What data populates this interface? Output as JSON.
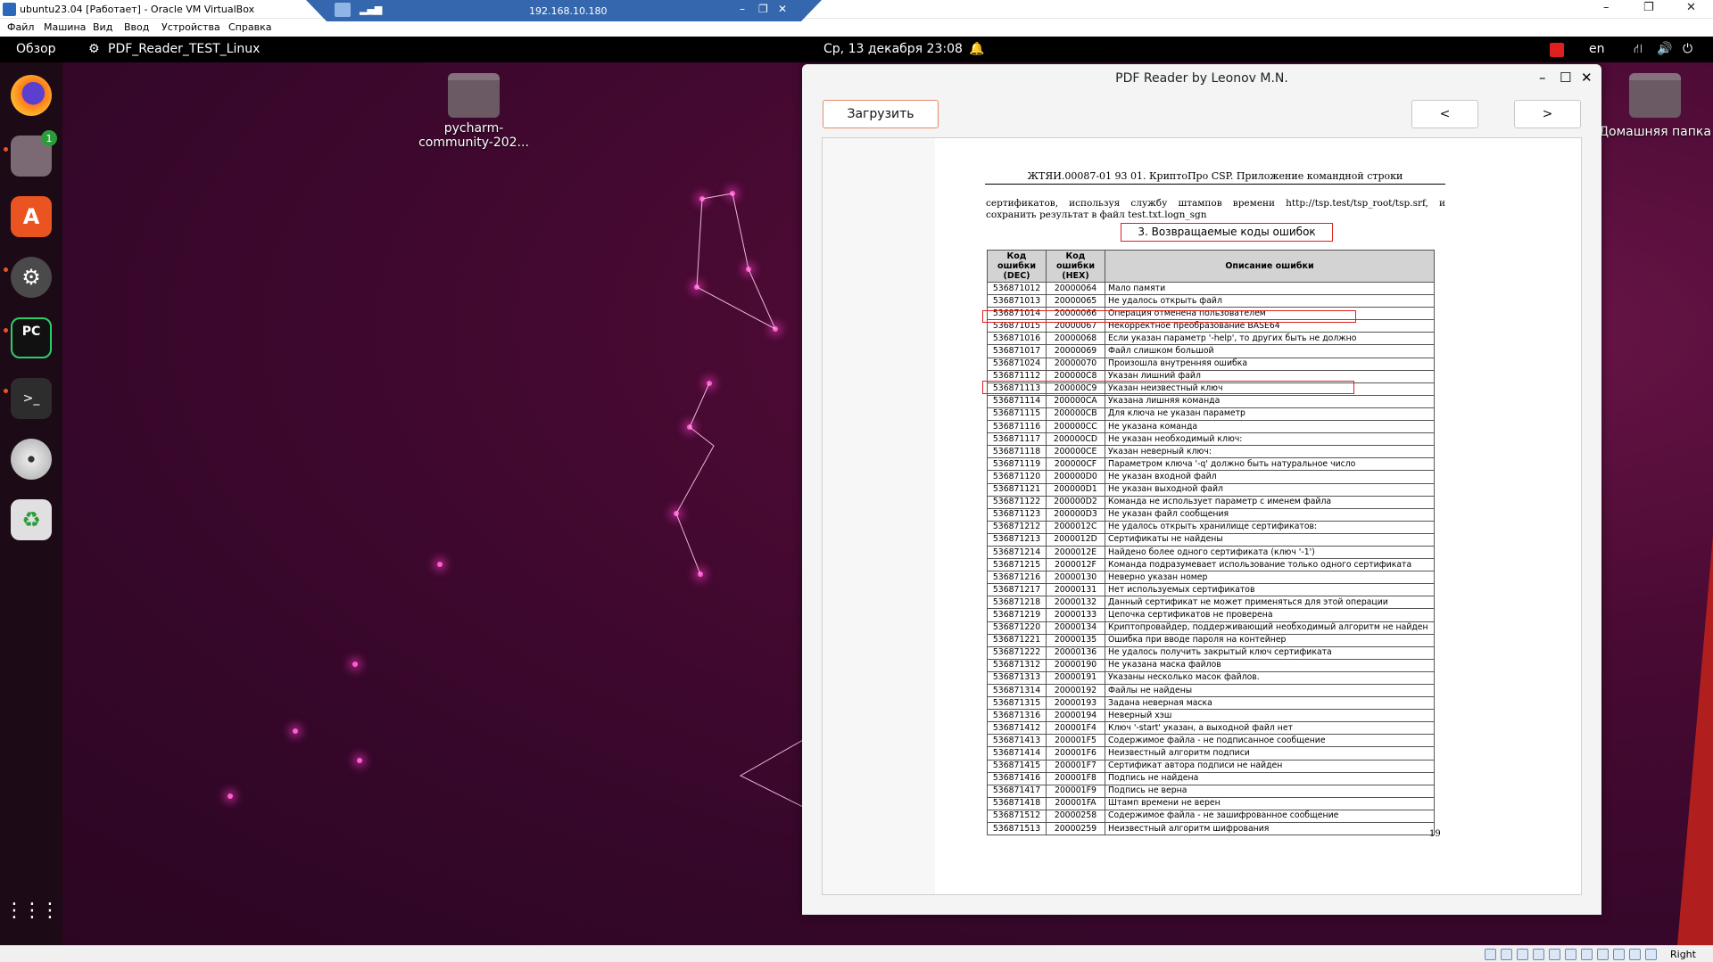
{
  "host": {
    "title": "ubuntu23.04 [Работает] - Oracle VM VirtualBox",
    "menu": [
      "Файл",
      "Машина",
      "Вид",
      "Ввод",
      "Устройства",
      "Справка"
    ],
    "rdp_ip": "192.168.10.180",
    "status_key": "Right Ctrl"
  },
  "topbar": {
    "overview": "Обзор",
    "app_name": "PDF_Reader_TEST_Linux",
    "datetime": "Ср, 13 декабря  23:08",
    "lang": "en"
  },
  "dock": {
    "files_badge": "1",
    "items": [
      "firefox-icon",
      "files-icon",
      "app-center-icon",
      "settings-icon",
      "pycharm-icon",
      "terminal-icon",
      "disc-icon",
      "trash-icon",
      "app-grid-icon"
    ],
    "pycharm_label": "PC"
  },
  "desktop": {
    "folder_label": "pycharm-community-202...",
    "home_label": "Домашняя папка"
  },
  "app": {
    "title": "PDF Reader by Leonov M.N.",
    "load_button": "Загрузить",
    "prev_button": "<",
    "next_button": ">",
    "doc": {
      "header": "ЖТЯИ.00087-01 93 01. КриптоПро CSP. Приложение командной строки",
      "para": "сертификатов, используя службу штампов времени http://tsp.test/tsp_root/tsp.srf, и сохранить результат в файл test.txt.logn_sgn",
      "section": "3. Возвращаемые коды ошибок",
      "col_dec": "Код ошибки (DEC)",
      "col_hex": "Код ошибки (HEX)",
      "col_desc": "Описание ошибки",
      "page_number": "19",
      "rows": [
        [
          "536871012",
          "20000064",
          "Мало памяти"
        ],
        [
          "536871013",
          "20000065",
          "Не удалось открыть файл"
        ],
        [
          "536871014",
          "20000066",
          "Операция отменена пользователем"
        ],
        [
          "536871015",
          "20000067",
          "Некорректное преобразование BASE64"
        ],
        [
          "536871016",
          "20000068",
          "Если указан параметр '-help', то других быть не должно"
        ],
        [
          "536871017",
          "20000069",
          "Файл слишком большой"
        ],
        [
          "536871024",
          "20000070",
          "Произошла внутренняя ошибка"
        ],
        [
          "536871112",
          "200000C8",
          "Указан лишний файл"
        ],
        [
          "536871113",
          "200000C9",
          "Указан неизвестный ключ"
        ],
        [
          "536871114",
          "200000CA",
          "Указана лишняя команда"
        ],
        [
          "536871115",
          "200000CB",
          "Для ключа не указан параметр"
        ],
        [
          "536871116",
          "200000CC",
          "Не указана команда"
        ],
        [
          "536871117",
          "200000CD",
          "Не указан необходимый ключ:"
        ],
        [
          "536871118",
          "200000CE",
          "Указан неверный ключ:"
        ],
        [
          "536871119",
          "200000CF",
          "Параметром ключа '-q' должно быть натуральное число"
        ],
        [
          "536871120",
          "200000D0",
          "Не указан входной файл"
        ],
        [
          "536871121",
          "200000D1",
          "Не указан выходной файл"
        ],
        [
          "536871122",
          "200000D2",
          "Команда не использует параметр с именем файла"
        ],
        [
          "536871123",
          "200000D3",
          "Не указан файл сообщения"
        ],
        [
          "536871212",
          "2000012C",
          "Не удалось открыть хранилище сертификатов:"
        ],
        [
          "536871213",
          "2000012D",
          "Сертификаты не найдены"
        ],
        [
          "536871214",
          "2000012E",
          "Найдено более одного сертификата (ключ '-1')"
        ],
        [
          "536871215",
          "2000012F",
          "Команда подразумевает использование только одного сертификата"
        ],
        [
          "536871216",
          "20000130",
          "Неверно указан номер"
        ],
        [
          "536871217",
          "20000131",
          "Нет используемых сертификатов"
        ],
        [
          "536871218",
          "20000132",
          "Данный сертификат не может применяться для этой операции"
        ],
        [
          "536871219",
          "20000133",
          "Цепочка сертификатов не проверена"
        ],
        [
          "536871220",
          "20000134",
          "Криптопровайдер, поддерживающий необходимый алгоритм не найден"
        ],
        [
          "536871221",
          "20000135",
          "Ошибка при вводе пароля на контейнер"
        ],
        [
          "536871222",
          "20000136",
          "Не удалось получить закрытый ключ сертификата"
        ],
        [
          "536871312",
          "20000190",
          "Не указана маска файлов"
        ],
        [
          "536871313",
          "20000191",
          "Указаны несколько масок файлов."
        ],
        [
          "536871314",
          "20000192",
          "Файлы не найдены"
        ],
        [
          "536871315",
          "20000193",
          "Задана неверная маска"
        ],
        [
          "536871316",
          "20000194",
          "Неверный хэш"
        ],
        [
          "536871412",
          "200001F4",
          "Ключ '-start' указан, а выходной файл нет"
        ],
        [
          "536871413",
          "200001F5",
          "Содержимое файла - не подписанное сообщение"
        ],
        [
          "536871414",
          "200001F6",
          "Неизвестный алгоритм подписи"
        ],
        [
          "536871415",
          "200001F7",
          "Сертификат автора подписи не найден"
        ],
        [
          "536871416",
          "200001F8",
          "Подпись не найдена"
        ],
        [
          "536871417",
          "200001F9",
          "Подпись не верна"
        ],
        [
          "536871418",
          "200001FA",
          "Штамп времени не верен"
        ],
        [
          "536871512",
          "20000258",
          "Содержимое файла - не зашифрованное сообщение"
        ],
        [
          "536871513",
          "20000259",
          "Неизвестный алгоритм шифрования"
        ]
      ]
    }
  },
  "colors": {
    "accent": "#e95420",
    "highlight": "#e02020",
    "rdp_bar": "#3467ad"
  }
}
